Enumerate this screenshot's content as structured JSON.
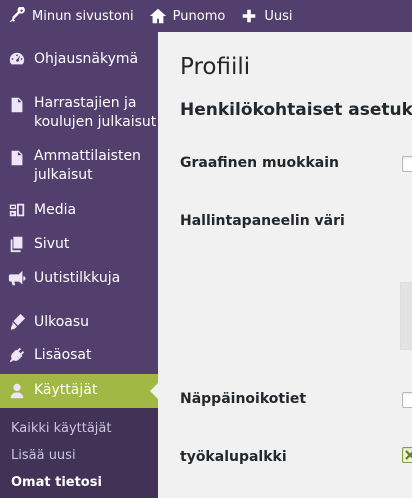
{
  "adminbar": {
    "my_sites": "Minun sivustoni",
    "site_name": "Punomo",
    "new": "Uusi"
  },
  "sidebar": {
    "items": [
      {
        "label": "Ohjausnäkymä",
        "icon": "dashboard-icon"
      },
      {
        "label": "Harrastajien ja koulujen julkaisut",
        "icon": "document-icon"
      },
      {
        "label": "Ammattilaisten julkaisut",
        "icon": "document-icon"
      },
      {
        "label": "Media",
        "icon": "media-icon"
      },
      {
        "label": "Sivut",
        "icon": "pages-icon"
      },
      {
        "label": "Uutistilkkuja",
        "icon": "megaphone-icon"
      },
      {
        "label": "Ulkoasu",
        "icon": "appearance-icon"
      },
      {
        "label": "Lisäosat",
        "icon": "plugins-icon"
      },
      {
        "label": "Käyttäjät",
        "icon": "users-icon"
      }
    ],
    "submenu": [
      "Kaikki käyttäjät",
      "Lisää uusi",
      "Omat tietosi"
    ]
  },
  "main": {
    "title": "Profiili",
    "section": "Henkilökohtaiset asetukset",
    "fields": {
      "visual_editor": {
        "label": "Graafinen muokkain",
        "checked": false
      },
      "admin_color": {
        "label": "Hallintapaneelin väri"
      },
      "keyboard_shortcuts": {
        "label": "Näppäinoikotiet",
        "checked": false
      },
      "toolbar": {
        "label": "työkalupalkki",
        "checked": true
      }
    }
  },
  "colors": {
    "sidebar_bg": "#523f6d",
    "submenu_bg": "#413256",
    "active_bg": "#a3b745",
    "content_bg": "#f1f1f1"
  }
}
